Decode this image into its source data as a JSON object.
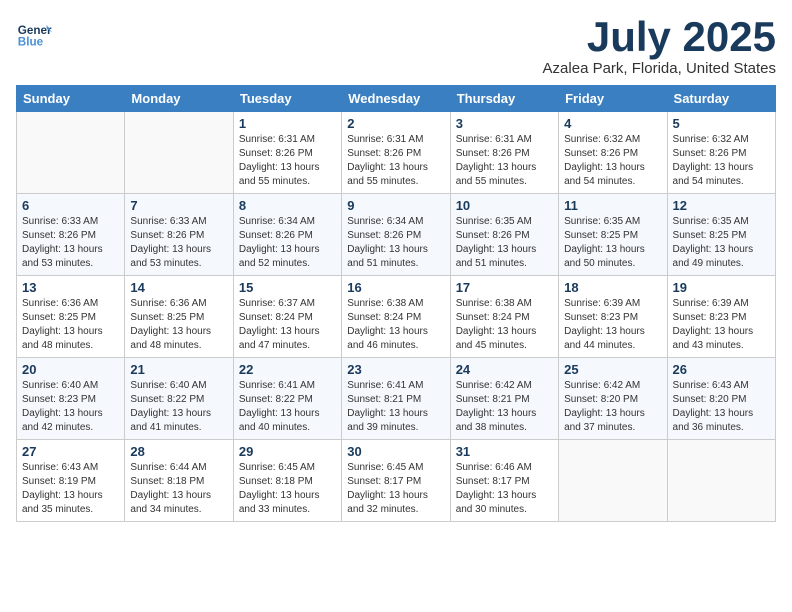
{
  "logo": {
    "line1": "General",
    "line2": "Blue"
  },
  "title": "July 2025",
  "location": "Azalea Park, Florida, United States",
  "weekdays": [
    "Sunday",
    "Monday",
    "Tuesday",
    "Wednesday",
    "Thursday",
    "Friday",
    "Saturday"
  ],
  "weeks": [
    [
      {
        "day": "",
        "info": ""
      },
      {
        "day": "",
        "info": ""
      },
      {
        "day": "1",
        "info": "Sunrise: 6:31 AM\nSunset: 8:26 PM\nDaylight: 13 hours and 55 minutes."
      },
      {
        "day": "2",
        "info": "Sunrise: 6:31 AM\nSunset: 8:26 PM\nDaylight: 13 hours and 55 minutes."
      },
      {
        "day": "3",
        "info": "Sunrise: 6:31 AM\nSunset: 8:26 PM\nDaylight: 13 hours and 55 minutes."
      },
      {
        "day": "4",
        "info": "Sunrise: 6:32 AM\nSunset: 8:26 PM\nDaylight: 13 hours and 54 minutes."
      },
      {
        "day": "5",
        "info": "Sunrise: 6:32 AM\nSunset: 8:26 PM\nDaylight: 13 hours and 54 minutes."
      }
    ],
    [
      {
        "day": "6",
        "info": "Sunrise: 6:33 AM\nSunset: 8:26 PM\nDaylight: 13 hours and 53 minutes."
      },
      {
        "day": "7",
        "info": "Sunrise: 6:33 AM\nSunset: 8:26 PM\nDaylight: 13 hours and 53 minutes."
      },
      {
        "day": "8",
        "info": "Sunrise: 6:34 AM\nSunset: 8:26 PM\nDaylight: 13 hours and 52 minutes."
      },
      {
        "day": "9",
        "info": "Sunrise: 6:34 AM\nSunset: 8:26 PM\nDaylight: 13 hours and 51 minutes."
      },
      {
        "day": "10",
        "info": "Sunrise: 6:35 AM\nSunset: 8:26 PM\nDaylight: 13 hours and 51 minutes."
      },
      {
        "day": "11",
        "info": "Sunrise: 6:35 AM\nSunset: 8:25 PM\nDaylight: 13 hours and 50 minutes."
      },
      {
        "day": "12",
        "info": "Sunrise: 6:35 AM\nSunset: 8:25 PM\nDaylight: 13 hours and 49 minutes."
      }
    ],
    [
      {
        "day": "13",
        "info": "Sunrise: 6:36 AM\nSunset: 8:25 PM\nDaylight: 13 hours and 48 minutes."
      },
      {
        "day": "14",
        "info": "Sunrise: 6:36 AM\nSunset: 8:25 PM\nDaylight: 13 hours and 48 minutes."
      },
      {
        "day": "15",
        "info": "Sunrise: 6:37 AM\nSunset: 8:24 PM\nDaylight: 13 hours and 47 minutes."
      },
      {
        "day": "16",
        "info": "Sunrise: 6:38 AM\nSunset: 8:24 PM\nDaylight: 13 hours and 46 minutes."
      },
      {
        "day": "17",
        "info": "Sunrise: 6:38 AM\nSunset: 8:24 PM\nDaylight: 13 hours and 45 minutes."
      },
      {
        "day": "18",
        "info": "Sunrise: 6:39 AM\nSunset: 8:23 PM\nDaylight: 13 hours and 44 minutes."
      },
      {
        "day": "19",
        "info": "Sunrise: 6:39 AM\nSunset: 8:23 PM\nDaylight: 13 hours and 43 minutes."
      }
    ],
    [
      {
        "day": "20",
        "info": "Sunrise: 6:40 AM\nSunset: 8:23 PM\nDaylight: 13 hours and 42 minutes."
      },
      {
        "day": "21",
        "info": "Sunrise: 6:40 AM\nSunset: 8:22 PM\nDaylight: 13 hours and 41 minutes."
      },
      {
        "day": "22",
        "info": "Sunrise: 6:41 AM\nSunset: 8:22 PM\nDaylight: 13 hours and 40 minutes."
      },
      {
        "day": "23",
        "info": "Sunrise: 6:41 AM\nSunset: 8:21 PM\nDaylight: 13 hours and 39 minutes."
      },
      {
        "day": "24",
        "info": "Sunrise: 6:42 AM\nSunset: 8:21 PM\nDaylight: 13 hours and 38 minutes."
      },
      {
        "day": "25",
        "info": "Sunrise: 6:42 AM\nSunset: 8:20 PM\nDaylight: 13 hours and 37 minutes."
      },
      {
        "day": "26",
        "info": "Sunrise: 6:43 AM\nSunset: 8:20 PM\nDaylight: 13 hours and 36 minutes."
      }
    ],
    [
      {
        "day": "27",
        "info": "Sunrise: 6:43 AM\nSunset: 8:19 PM\nDaylight: 13 hours and 35 minutes."
      },
      {
        "day": "28",
        "info": "Sunrise: 6:44 AM\nSunset: 8:18 PM\nDaylight: 13 hours and 34 minutes."
      },
      {
        "day": "29",
        "info": "Sunrise: 6:45 AM\nSunset: 8:18 PM\nDaylight: 13 hours and 33 minutes."
      },
      {
        "day": "30",
        "info": "Sunrise: 6:45 AM\nSunset: 8:17 PM\nDaylight: 13 hours and 32 minutes."
      },
      {
        "day": "31",
        "info": "Sunrise: 6:46 AM\nSunset: 8:17 PM\nDaylight: 13 hours and 30 minutes."
      },
      {
        "day": "",
        "info": ""
      },
      {
        "day": "",
        "info": ""
      }
    ]
  ]
}
